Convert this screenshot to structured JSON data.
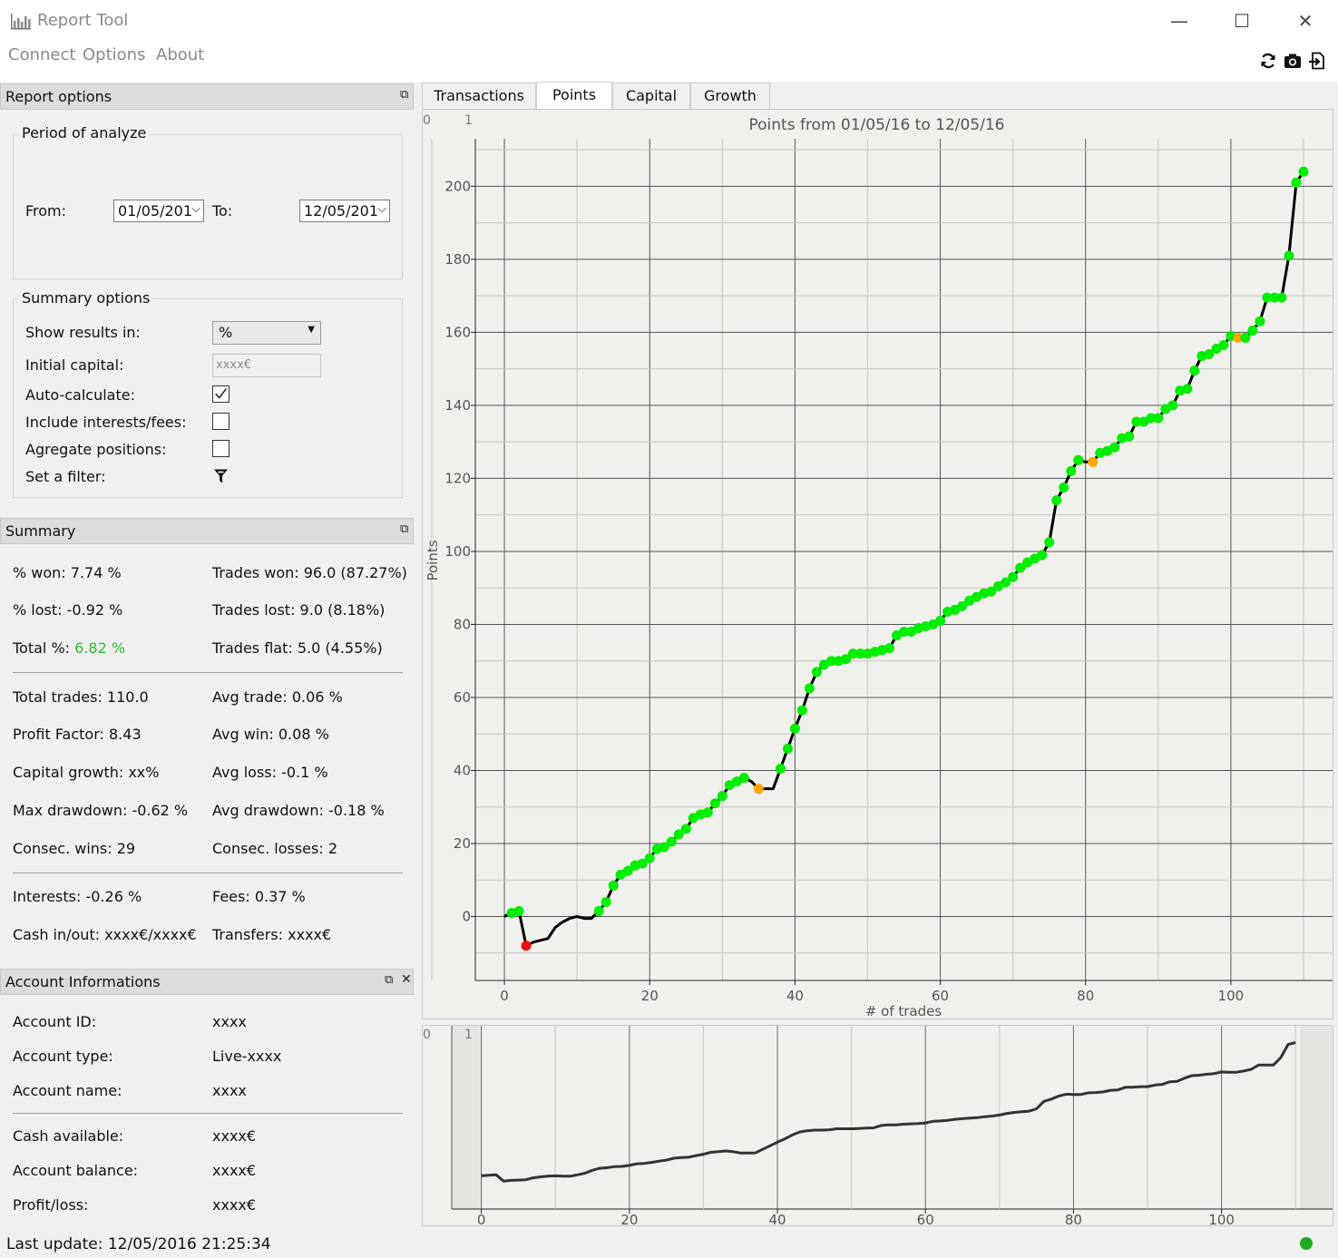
{
  "window": {
    "title": "Report Tool",
    "controls": {
      "minimize": "—",
      "maximize": "☐",
      "close": "✕"
    }
  },
  "menu": [
    "Connect",
    "Options",
    "About"
  ],
  "toolbar_icons": [
    "refresh-icon",
    "camera-icon",
    "export-icon"
  ],
  "report_options": {
    "header": "Report options",
    "period": {
      "title": "Period of analyze",
      "from_label": "From:",
      "from_value": "01/05/201",
      "to_label": "To:",
      "to_value": "12/05/201"
    },
    "summary_options": {
      "title": "Summary options",
      "show_results_label": "Show results in:",
      "show_results_value": "%",
      "initial_capital_label": "Initial capital:",
      "initial_capital_placeholder": "xxxx€",
      "auto_calculate_label": "Auto-calculate:",
      "auto_calculate_checked": true,
      "include_fees_label": "Include interests/fees:",
      "include_fees_checked": false,
      "aggregate_label": "Agregate positions:",
      "aggregate_checked": false,
      "filter_label": "Set a filter:"
    }
  },
  "summary": {
    "header": "Summary",
    "pct_won": "% won: 7.74 %",
    "trades_won": "Trades won: 96.0 (87.27%)",
    "pct_lost": "% lost: -0.92 %",
    "trades_lost": "Trades lost: 9.0 (8.18%)",
    "total_label": "Total %: ",
    "total_value": "6.82 %",
    "total_color": "#2ebd2e",
    "trades_flat": "Trades flat: 5.0 (4.55%)",
    "total_trades": "Total trades: 110.0",
    "avg_trade": "Avg trade: 0.06 %",
    "profit_factor": "Profit Factor: 8.43",
    "avg_win": "Avg win: 0.08 %",
    "capital_growth": "Capital growth: xx%",
    "avg_loss": "Avg loss: -0.1 %",
    "max_drawdown": "Max drawdown: -0.62 %",
    "avg_drawdown": "Avg drawdown: -0.18 %",
    "consec_wins": "Consec. wins: 29",
    "consec_losses": "Consec. losses: 2",
    "interests": "Interests: -0.26 %",
    "fees": "Fees: 0.37 %",
    "cash_inout": "Cash in/out: xxxx€/xxxx€",
    "transfers": "Transfers: xxxx€"
  },
  "account": {
    "header": "Account Informations",
    "id_label": "Account ID:",
    "id_value": "xxxx",
    "type_label": "Account type:",
    "type_value": "Live-xxxx",
    "name_label": "Account name:",
    "name_value": "xxxx",
    "cash_label": "Cash available:",
    "cash_value": "xxxx€",
    "balance_label": "Account balance:",
    "balance_value": "xxxx€",
    "pl_label": "Profit/loss:",
    "pl_value": "xxxx€"
  },
  "tabs": [
    "Transactions",
    "Points",
    "Capital",
    "Growth"
  ],
  "active_tab": "Points",
  "status": {
    "last_update": "Last update: 12/05/2016 21:25:34",
    "indicator_color": "#1fa81f"
  },
  "colors": {
    "win": "#00ee00",
    "loss": "#ee1111",
    "flat": "#ffa500",
    "line": "#000000"
  },
  "chart_data": {
    "type": "line",
    "title": "Points from 01/05/16 to 12/05/16",
    "xlabel": "# of trades",
    "ylabel": "Points",
    "corner_labels": [
      "0",
      "1"
    ],
    "xlim": [
      -4,
      114
    ],
    "ylim": [
      -17.5,
      213
    ],
    "xticks": [
      0,
      20,
      40,
      60,
      80,
      100
    ],
    "yticks": [
      0,
      20,
      40,
      60,
      80,
      100,
      120,
      140,
      160,
      180,
      200
    ],
    "grid": true,
    "x": [
      0,
      1,
      2,
      3,
      4,
      5,
      6,
      7,
      8,
      9,
      10,
      11,
      12,
      13,
      14,
      15,
      16,
      17,
      18,
      19,
      20,
      21,
      22,
      23,
      24,
      25,
      26,
      27,
      28,
      29,
      30,
      31,
      32,
      33,
      34,
      35,
      36,
      37,
      38,
      39,
      40,
      41,
      42,
      43,
      44,
      45,
      46,
      47,
      48,
      49,
      50,
      51,
      52,
      53,
      54,
      55,
      56,
      57,
      58,
      59,
      60,
      61,
      62,
      63,
      64,
      65,
      66,
      67,
      68,
      69,
      70,
      71,
      72,
      73,
      74,
      75,
      76,
      77,
      78,
      79,
      80,
      81,
      82,
      83,
      84,
      85,
      86,
      87,
      88,
      89,
      90,
      91,
      92,
      93,
      94,
      95,
      96,
      97,
      98,
      99,
      100,
      101,
      102,
      103,
      104,
      105,
      106,
      107,
      108,
      109,
      110
    ],
    "y": [
      0,
      1,
      1.5,
      -8,
      -7,
      -6.5,
      -6,
      -3,
      -1.5,
      -0.5,
      0,
      -0.5,
      -0.5,
      1.5,
      4,
      8.5,
      11.5,
      12.5,
      14,
      14.5,
      16,
      18.5,
      19,
      20.5,
      22.5,
      24,
      27,
      28,
      28.5,
      31,
      33,
      36,
      37,
      38,
      37,
      35,
      35,
      35,
      40.5,
      46,
      51.5,
      56.5,
      62.5,
      67,
      69,
      70,
      70,
      70.5,
      72,
      72,
      72,
      72.5,
      73,
      73.5,
      77,
      78,
      78,
      79,
      79.5,
      80,
      81,
      83.5,
      84,
      85,
      86.5,
      87.5,
      88.5,
      89,
      90.5,
      91.5,
      93,
      95.5,
      97,
      98,
      99,
      102.5,
      114,
      117.5,
      122,
      125,
      124.5,
      124.5,
      127,
      127.5,
      128.5,
      131,
      131.5,
      135.5,
      135.5,
      136.5,
      136.5,
      139,
      140,
      144,
      144.5,
      149.5,
      153.5,
      154,
      155.5,
      156.5,
      159,
      158.5,
      158.5,
      160.5,
      163,
      169.5,
      169.5,
      169.5,
      181,
      201,
      204
    ],
    "point_types": [
      "",
      "w",
      "w",
      "l",
      "",
      "",
      "",
      "",
      "",
      "",
      "",
      "",
      "",
      "w",
      "w",
      "w",
      "w",
      "w",
      "w",
      "w",
      "w",
      "w",
      "w",
      "w",
      "w",
      "w",
      "w",
      "w",
      "w",
      "w",
      "w",
      "w",
      "w",
      "w",
      "",
      "f",
      "",
      "",
      "w",
      "w",
      "w",
      "w",
      "w",
      "w",
      "w",
      "w",
      "w",
      "w",
      "w",
      "w",
      "w",
      "w",
      "w",
      "w",
      "w",
      "w",
      "w",
      "w",
      "w",
      "w",
      "w",
      "w",
      "w",
      "w",
      "w",
      "w",
      "w",
      "w",
      "w",
      "w",
      "w",
      "w",
      "w",
      "w",
      "w",
      "w",
      "w",
      "w",
      "w",
      "w",
      "",
      "f",
      "w",
      "w",
      "w",
      "w",
      "w",
      "w",
      "w",
      "w",
      "w",
      "w",
      "w",
      "w",
      "w",
      "w",
      "w",
      "w",
      "w",
      "w",
      "w",
      "f",
      "w",
      "w",
      "w",
      "w",
      "w",
      "w",
      "w",
      "w",
      "w"
    ],
    "overview": {
      "type": "line",
      "xticks": [
        0,
        20,
        40,
        60,
        80,
        100
      ],
      "xlim": [
        -4,
        115
      ],
      "corner_labels": [
        "0",
        "1"
      ]
    }
  }
}
